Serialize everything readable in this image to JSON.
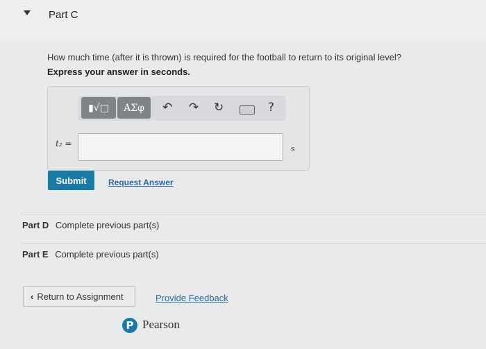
{
  "part_c": {
    "title": "Part C",
    "question": "How much time (after it is thrown) is required for the football to return to its original level?",
    "instruction": "Express your answer in seconds."
  },
  "toolbar": {
    "sqrt_template": "▮√□",
    "greek": "ΑΣφ",
    "undo": "↶",
    "redo": "↷",
    "reset": "↻",
    "help": "?"
  },
  "answer": {
    "variable": "t₂ =",
    "value": "",
    "unit": "s"
  },
  "actions": {
    "submit": "Submit",
    "request_answer": "Request Answer"
  },
  "parts": [
    {
      "label": "Part D",
      "status": "Complete previous part(s)"
    },
    {
      "label": "Part E",
      "status": "Complete previous part(s)"
    }
  ],
  "footer": {
    "return": "Return to Assignment",
    "return_chevron": "‹",
    "feedback": "Provide Feedback",
    "brand_initial": "P",
    "brand": "Pearson"
  }
}
